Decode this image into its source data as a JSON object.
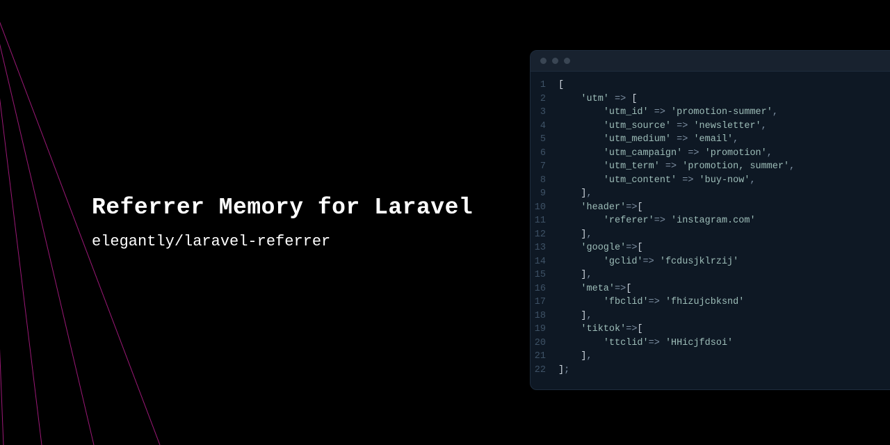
{
  "title": "Referrer Memory for Laravel",
  "subtitle": "elegantly/laravel-referrer",
  "code": {
    "lines": [
      {
        "n": 1,
        "indent": 0,
        "tokens": [
          {
            "t": "bracket",
            "v": "["
          }
        ]
      },
      {
        "n": 2,
        "indent": 1,
        "tokens": [
          {
            "t": "str",
            "v": "'utm'"
          },
          {
            "t": "arrow",
            "v": " => "
          },
          {
            "t": "bracket",
            "v": "["
          }
        ]
      },
      {
        "n": 3,
        "indent": 2,
        "tokens": [
          {
            "t": "str",
            "v": "'utm_id'"
          },
          {
            "t": "arrow",
            "v": " => "
          },
          {
            "t": "str",
            "v": "'promotion-summer'"
          },
          {
            "t": "punc",
            "v": ","
          }
        ]
      },
      {
        "n": 4,
        "indent": 2,
        "tokens": [
          {
            "t": "str",
            "v": "'utm_source'"
          },
          {
            "t": "arrow",
            "v": " => "
          },
          {
            "t": "str",
            "v": "'newsletter'"
          },
          {
            "t": "punc",
            "v": ","
          }
        ]
      },
      {
        "n": 5,
        "indent": 2,
        "tokens": [
          {
            "t": "str",
            "v": "'utm_medium'"
          },
          {
            "t": "arrow",
            "v": " => "
          },
          {
            "t": "str",
            "v": "'email'"
          },
          {
            "t": "punc",
            "v": ","
          }
        ]
      },
      {
        "n": 6,
        "indent": 2,
        "tokens": [
          {
            "t": "str",
            "v": "'utm_campaign'"
          },
          {
            "t": "arrow",
            "v": " => "
          },
          {
            "t": "str",
            "v": "'promotion'"
          },
          {
            "t": "punc",
            "v": ","
          }
        ]
      },
      {
        "n": 7,
        "indent": 2,
        "tokens": [
          {
            "t": "str",
            "v": "'utm_term'"
          },
          {
            "t": "arrow",
            "v": " => "
          },
          {
            "t": "str",
            "v": "'promotion, summer'"
          },
          {
            "t": "punc",
            "v": ","
          }
        ]
      },
      {
        "n": 8,
        "indent": 2,
        "tokens": [
          {
            "t": "str",
            "v": "'utm_content'"
          },
          {
            "t": "arrow",
            "v": " => "
          },
          {
            "t": "str",
            "v": "'buy-now'"
          },
          {
            "t": "punc",
            "v": ","
          }
        ]
      },
      {
        "n": 9,
        "indent": 1,
        "tokens": [
          {
            "t": "bracket",
            "v": "]"
          },
          {
            "t": "punc",
            "v": ","
          }
        ]
      },
      {
        "n": 10,
        "indent": 1,
        "tokens": [
          {
            "t": "str",
            "v": "'header'"
          },
          {
            "t": "arrow",
            "v": "=>"
          },
          {
            "t": "bracket",
            "v": "["
          }
        ]
      },
      {
        "n": 11,
        "indent": 2,
        "tokens": [
          {
            "t": "str",
            "v": "'referer'"
          },
          {
            "t": "arrow",
            "v": "=> "
          },
          {
            "t": "str",
            "v": "'instagram.com'"
          }
        ]
      },
      {
        "n": 12,
        "indent": 1,
        "tokens": [
          {
            "t": "bracket",
            "v": "]"
          },
          {
            "t": "punc",
            "v": ","
          }
        ]
      },
      {
        "n": 13,
        "indent": 1,
        "tokens": [
          {
            "t": "str",
            "v": "'google'"
          },
          {
            "t": "arrow",
            "v": "=>"
          },
          {
            "t": "bracket",
            "v": "["
          }
        ]
      },
      {
        "n": 14,
        "indent": 2,
        "tokens": [
          {
            "t": "str",
            "v": "'gclid'"
          },
          {
            "t": "arrow",
            "v": "=> "
          },
          {
            "t": "str",
            "v": "'fcdusjklrzij'"
          }
        ]
      },
      {
        "n": 15,
        "indent": 1,
        "tokens": [
          {
            "t": "bracket",
            "v": "]"
          },
          {
            "t": "punc",
            "v": ","
          }
        ]
      },
      {
        "n": 16,
        "indent": 1,
        "tokens": [
          {
            "t": "str",
            "v": "'meta'"
          },
          {
            "t": "arrow",
            "v": "=>"
          },
          {
            "t": "bracket",
            "v": "["
          }
        ]
      },
      {
        "n": 17,
        "indent": 2,
        "tokens": [
          {
            "t": "str",
            "v": "'fbclid'"
          },
          {
            "t": "arrow",
            "v": "=> "
          },
          {
            "t": "str",
            "v": "'fhizujcbksnd'"
          }
        ]
      },
      {
        "n": 18,
        "indent": 1,
        "tokens": [
          {
            "t": "bracket",
            "v": "]"
          },
          {
            "t": "punc",
            "v": ","
          }
        ]
      },
      {
        "n": 19,
        "indent": 1,
        "tokens": [
          {
            "t": "str",
            "v": "'tiktok'"
          },
          {
            "t": "arrow",
            "v": "=>"
          },
          {
            "t": "bracket",
            "v": "["
          }
        ]
      },
      {
        "n": 20,
        "indent": 2,
        "tokens": [
          {
            "t": "str",
            "v": "'ttclid'"
          },
          {
            "t": "arrow",
            "v": "=> "
          },
          {
            "t": "str",
            "v": "'HHicjfdsoi'"
          }
        ]
      },
      {
        "n": 21,
        "indent": 1,
        "tokens": [
          {
            "t": "bracket",
            "v": "]"
          },
          {
            "t": "punc",
            "v": ","
          }
        ]
      },
      {
        "n": 22,
        "indent": 0,
        "tokens": [
          {
            "t": "bracket",
            "v": "]"
          },
          {
            "t": "punc",
            "v": ";"
          }
        ]
      }
    ]
  }
}
